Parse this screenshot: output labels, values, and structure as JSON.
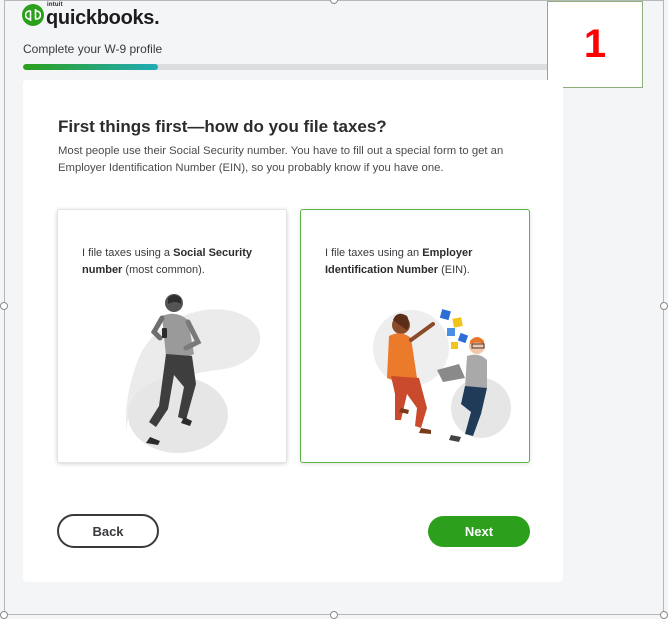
{
  "brand": {
    "parent": "intuit",
    "name": "quickbooks.",
    "logo_icon": "quickbooks-logo-icon",
    "accent": "#2ca01c"
  },
  "header": {
    "profile_label": "Complete your W-9 profile",
    "progress_fraction": 0.25
  },
  "annotation": {
    "step_number": "1",
    "color": "#ff0000"
  },
  "main": {
    "title": "First things first—how do you file taxes?",
    "description": "Most people use their Social Security number. You have to fill out a special form to get an Employer Identification Number (EIN), so you probably know if you have one.",
    "options": [
      {
        "prefix": "I file taxes using a ",
        "emphasis": "Social Security number",
        "suffix": " (most common).",
        "illustration": "person-walking-with-phone-illustration",
        "selected": false
      },
      {
        "prefix": "I file taxes using an ",
        "emphasis": "Employer Identification Number",
        "suffix": " (EIN).",
        "illustration": "two-people-with-laptop-illustration",
        "selected": true
      }
    ]
  },
  "footer": {
    "back_label": "Back",
    "next_label": "Next"
  }
}
